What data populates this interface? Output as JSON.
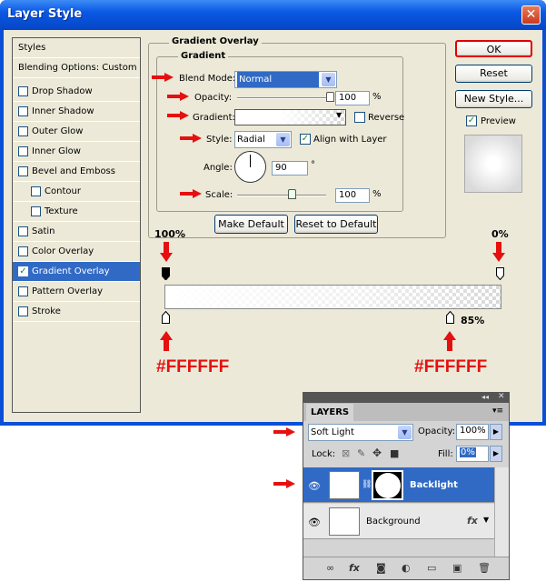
{
  "window": {
    "title": "Layer Style",
    "close_glyph": "✕"
  },
  "sidebar": {
    "items": [
      {
        "label": "Styles",
        "checkbox": false
      },
      {
        "label": "Blending Options: Custom",
        "checkbox": false
      },
      {
        "label": "Drop Shadow",
        "checkbox": true,
        "checked": false
      },
      {
        "label": "Inner Shadow",
        "checkbox": true,
        "checked": false
      },
      {
        "label": "Outer Glow",
        "checkbox": true,
        "checked": false
      },
      {
        "label": "Inner Glow",
        "checkbox": true,
        "checked": false
      },
      {
        "label": "Bevel and Emboss",
        "checkbox": true,
        "checked": false
      },
      {
        "label": "Contour",
        "checkbox": true,
        "checked": false,
        "sub": true
      },
      {
        "label": "Texture",
        "checkbox": true,
        "checked": false,
        "sub": true
      },
      {
        "label": "Satin",
        "checkbox": true,
        "checked": false
      },
      {
        "label": "Color Overlay",
        "checkbox": true,
        "checked": false
      },
      {
        "label": "Gradient Overlay",
        "checkbox": true,
        "checked": true,
        "selected": true
      },
      {
        "label": "Pattern Overlay",
        "checkbox": true,
        "checked": false
      },
      {
        "label": "Stroke",
        "checkbox": true,
        "checked": false
      }
    ]
  },
  "overlay": {
    "group_title": "Gradient Overlay",
    "sub_title": "Gradient",
    "blend_mode_label": "Blend Mode:",
    "blend_mode_value": "Normal",
    "opacity_label": "Opacity:",
    "opacity_value": "100",
    "opacity_unit": "%",
    "opacity_level": 1.0,
    "gradient_label": "Gradient:",
    "reverse_label": "Reverse",
    "style_label": "Style:",
    "style_value": "Radial",
    "align_label": "Align with Layer",
    "align_checked": true,
    "angle_label": "Angle:",
    "angle_value": "90",
    "angle_unit": "°",
    "scale_label": "Scale:",
    "scale_value": "100",
    "scale_unit": "%",
    "scale_level": 0.62,
    "make_default": "Make Default",
    "reset_default": "Reset to Default"
  },
  "buttons": {
    "ok": "OK",
    "reset": "Reset",
    "new_style": "New Style...",
    "preview": "Preview",
    "preview_checked": true
  },
  "gradient_editor": {
    "left_opacity": "100%",
    "right_opacity": "0%",
    "right_color_location": "85%",
    "left_color": "#FFFFFF",
    "right_color": "#FFFFFF"
  },
  "layers_panel": {
    "tab": "LAYERS",
    "blend_mode": "Soft Light",
    "opacity_label": "Opacity:",
    "opacity_value": "100%",
    "lock_label": "Lock:",
    "fill_label": "Fill:",
    "fill_value": "0%",
    "layers": [
      {
        "name": "Backlight",
        "selected": true
      },
      {
        "name": "Background",
        "selected": false,
        "fx": "fx"
      }
    ]
  },
  "colors": {
    "accent_red": "#e51010",
    "selection_blue": "#316ac5"
  }
}
